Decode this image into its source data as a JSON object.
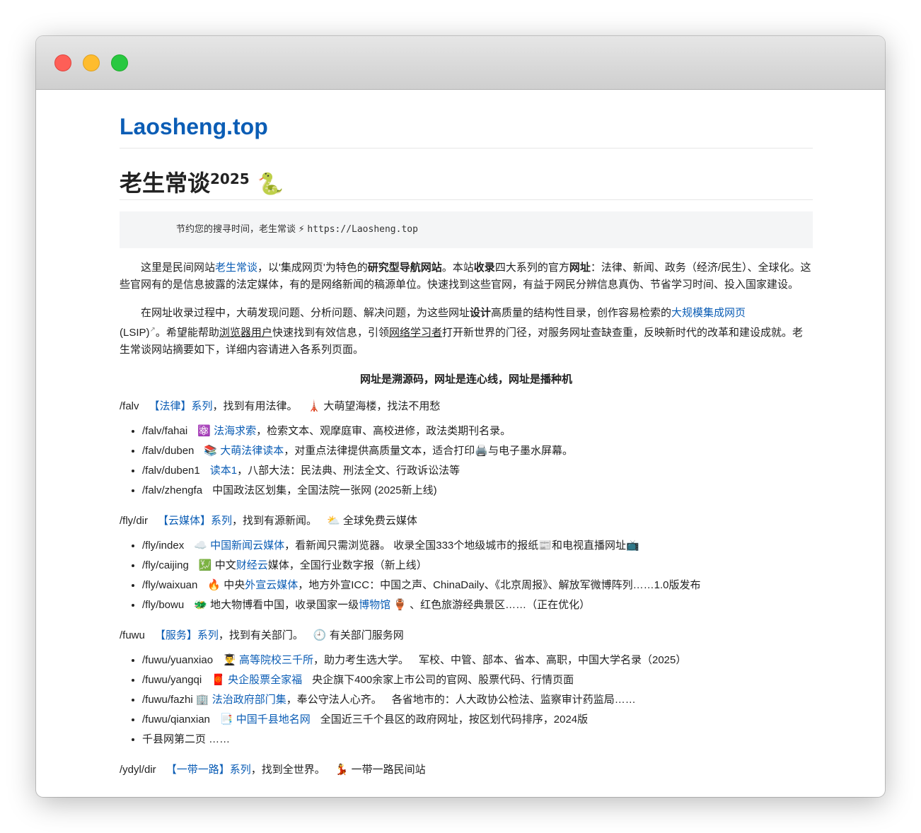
{
  "window": {
    "lights": [
      "close",
      "minimize",
      "zoom"
    ]
  },
  "site": {
    "title": "Laosheng.top"
  },
  "page": {
    "title": "老生常谈",
    "sup": "2025",
    "title_emoji": "🐍"
  },
  "banner": {
    "text": "节约您的搜寻时间，老生常谈",
    "bolt": "⚡",
    "url": "https://Laosheng.top"
  },
  "intro1": {
    "t1": "这里是民间网站",
    "link1": "老生常谈",
    "t2": "，以'集成网页'为特色的",
    "b1": "研究型导航网站",
    "t3": "。本站",
    "b2": "收录",
    "t4": "四大系列的官方",
    "b3": "网址",
    "t5": "：法律、新闻、政务（经济/民生）、全球化。这些官网有的是信息披露的法定媒体，有的是网络新闻的稿源单位。快速找到这些官网，有益于网民分辨信息真伪、节省学习时间、投入国家建设。"
  },
  "intro2": {
    "t1": "在网址收录过程中，大萌发现问题、分析问题、解决问题，为这些网址",
    "b1": "设计",
    "t2": "高质量的结构性目录，创作容易检索的",
    "link1": "大规模集成网页",
    "t3": "(LSIP)",
    "ext": "↗",
    "t4": "。希望能帮助",
    "u1": "浏览器用户",
    "t5": "快速找到有效信息，引领",
    "u2": "网络学习者",
    "t6": "打开新世界的门径，对服务网址查缺查重，反映新时代的改革和建设成就。老生常谈网站摘要如下，详细内容请进入各系列页面。"
  },
  "motto": "网址是溯源码，网址是连心线，网址是播种机",
  "sections": [
    {
      "path": "/falv",
      "link": "【法律】系列",
      "text": "，找到有用法律。",
      "emoji": "🗼",
      "tail": "大萌望海楼，找法不用愁",
      "items": [
        {
          "path": "/falv/fahai",
          "emoji": "⚛️",
          "link": "法海求索",
          "text": "，检索文本、观摩庭审、高校进修，政法类期刊名录。"
        },
        {
          "path": "/falv/duben",
          "emoji": "📚",
          "link": "大萌法律读本",
          "text": "，对重点法律提供高质量文本，适合打印🖨️与电子墨水屏幕。"
        },
        {
          "path": "/falv/duben1",
          "emoji": "",
          "link": "读本1",
          "text": "，八部大法：民法典、刑法全文、行政诉讼法等"
        },
        {
          "path": "/falv/zhengfa",
          "emoji": "",
          "link": "",
          "text": "中国政法区划集，全国法院一张网 (2025新上线)"
        }
      ]
    },
    {
      "path": "/fly/dir",
      "link": "【云媒体】系列",
      "text": "，找到有源新闻。",
      "emoji": "⛅",
      "tail": "全球免费云媒体",
      "items": [
        {
          "path": "/fly/index",
          "emoji": "☁️",
          "pre": "",
          "link": "中国新闻云媒体",
          "text": "，看新闻只需浏览器。 收录全国333个地级城市的报纸📰和电视直播网址📺"
        },
        {
          "path": "/fly/caijing",
          "emoji": "💹",
          "pre": "中文",
          "link": "财经云",
          "text": "媒体，全国行业数字报（新上线）"
        },
        {
          "path": "/fly/waixuan",
          "emoji": "🔥",
          "pre": "中央",
          "link": "外宣云媒体",
          "text": "，地方外宣ICC：中国之声、ChinaDaily、《北京周报》、解放军微博阵列……1.0版发布"
        },
        {
          "path": "/fly/bowu",
          "emoji": "🐲",
          "pre": "地大物博看中国，收录国家一级",
          "link": "博物馆",
          "text": " 🏺 、红色旅游经典景区……（正在优化）"
        }
      ]
    },
    {
      "path": "/fuwu",
      "link": "【服务】系列",
      "text": "，找到有关部门。",
      "emoji": "🕘",
      "tail": "有关部门服务网",
      "items": [
        {
          "path": "/fuwu/yuanxiao",
          "emoji": "👨‍🎓",
          "link": "高等院校三千所",
          "text": "，助力考生选大学。",
          "extra": "军校、中管、部本、省本、高职，中国大学名录（2025）"
        },
        {
          "path": "/fuwu/yangqi",
          "emoji": "🧧",
          "link": "央企股票全家福",
          "text": "",
          "extra": "央企旗下400余家上市公司的官网、股票代码、行情页面"
        },
        {
          "path": "/fuwu/fazhi",
          "emoji": "🏢",
          "link": "法治政府部门集",
          "text": "，奉公守法人心齐。",
          "extra": "各省地市的：人大政协公检法、监察审计药监局……"
        },
        {
          "path": "/fuwu/qianxian",
          "emoji": "📑",
          "link": "中国千县地名网",
          "text": "",
          "extra": "全国近三千个县区的政府网址，按区划代码排序，2024版"
        },
        {
          "path": "千县网第二页 ……",
          "emoji": "",
          "link": "",
          "text": "",
          "extra": ""
        }
      ]
    },
    {
      "path": "/ydyl/dir",
      "link": "【一带一路】系列",
      "text": "，找到全世界。",
      "emoji": "💃",
      "tail": "一带一路民间站",
      "items": []
    }
  ]
}
